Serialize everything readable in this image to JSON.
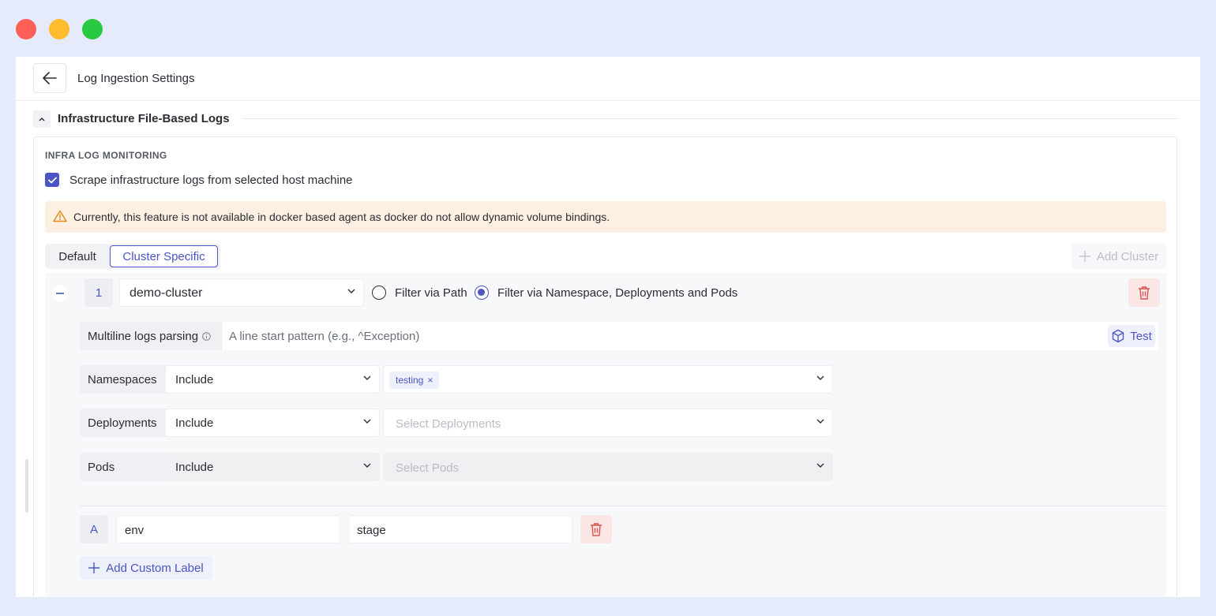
{
  "header": {
    "title": "Log Ingestion Settings"
  },
  "section": {
    "title": "Infrastructure File-Based Logs"
  },
  "monitoring": {
    "heading": "INFRA LOG MONITORING",
    "scrape_label": "Scrape infrastructure logs from selected host machine",
    "scrape_checked": true
  },
  "warning": {
    "text": "Currently, this feature is not available in docker based agent as docker do not allow dynamic volume bindings."
  },
  "tabs": [
    {
      "label": "Default",
      "active": false
    },
    {
      "label": "Cluster Specific",
      "active": true
    }
  ],
  "add_cluster_label": "Add Cluster",
  "cluster": {
    "index": "1",
    "name": "demo-cluster",
    "filter_options": [
      {
        "label": "Filter via Path",
        "selected": false
      },
      {
        "label": "Filter via Namespace, Deployments and Pods",
        "selected": true
      }
    ],
    "multiline": {
      "label": "Multiline logs parsing",
      "placeholder": "A line start pattern (e.g., ^Exception)",
      "test_label": "Test"
    },
    "filters": [
      {
        "label": "Namespaces",
        "mode": "Include",
        "chips": [
          "testing"
        ],
        "placeholder": ""
      },
      {
        "label": "Deployments",
        "mode": "Include",
        "chips": [],
        "placeholder": "Select Deployments"
      },
      {
        "label": "Pods",
        "mode": "Include",
        "chips": [],
        "placeholder": "Select Pods"
      }
    ],
    "custom_labels": [
      {
        "badge": "A",
        "key": "env",
        "value": "stage"
      }
    ],
    "add_custom_label": "Add Custom Label"
  },
  "colors": {
    "accent": "#4b55c4",
    "warning_bg": "#fdf0e3",
    "danger_bg": "#fbe6e6",
    "danger": "#d9534f",
    "frame_bg": "#e6ebfc"
  }
}
